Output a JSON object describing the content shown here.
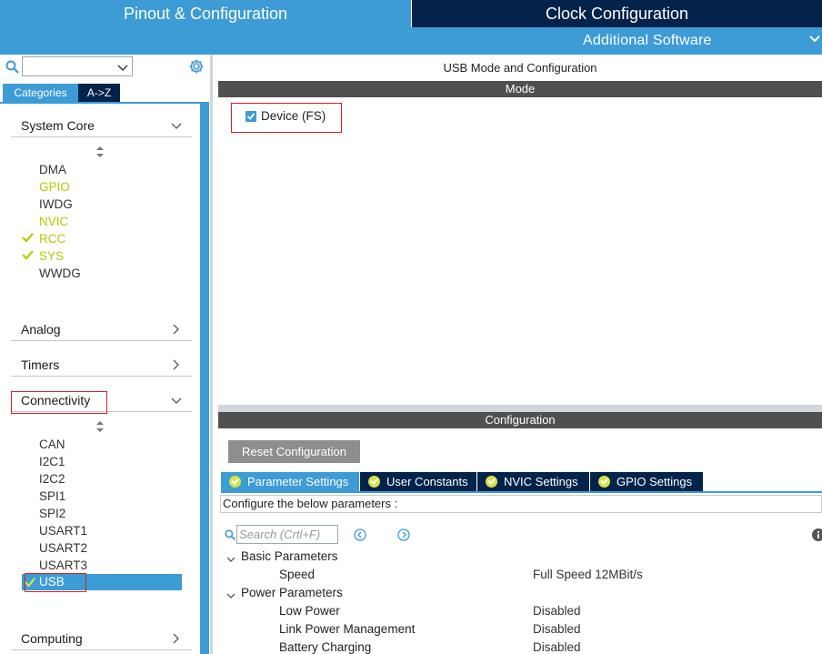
{
  "top_tabs": {
    "pinout": "Pinout & Configuration",
    "clock": "Clock Configuration"
  },
  "subbar": {
    "additional_software": "Additional Software"
  },
  "left": {
    "tabs": {
      "categories": "Categories",
      "az": "A->Z"
    },
    "categories": {
      "system_core": "System Core",
      "analog": "Analog",
      "timers": "Timers",
      "connectivity": "Connectivity",
      "computing": "Computing"
    },
    "system_core_items": [
      "DMA",
      "GPIO",
      "IWDG",
      "NVIC",
      "RCC",
      "SYS",
      "WWDG"
    ],
    "connectivity_items": [
      "CAN",
      "I2C1",
      "I2C2",
      "SPI1",
      "SPI2",
      "USART1",
      "USART2",
      "USART3",
      "USB"
    ]
  },
  "right": {
    "title": "USB Mode and Configuration",
    "mode_header": "Mode",
    "device_label": "Device (FS)",
    "config_header": "Configuration",
    "reset_button": "Reset Configuration",
    "config_tabs": [
      "Parameter Settings",
      "User Constants",
      "NVIC Settings",
      "GPIO Settings"
    ],
    "configure_text": "Configure the below parameters :",
    "search_placeholder": "Search (Crtl+F)",
    "groups": {
      "basic": "Basic Parameters",
      "power": "Power Parameters"
    },
    "params": [
      {
        "name": "Speed",
        "value": "Full Speed 12MBit/s"
      },
      {
        "name": "Low Power",
        "value": "Disabled"
      },
      {
        "name": "Link Power Management",
        "value": "Disabled"
      },
      {
        "name": "Battery Charging",
        "value": "Disabled"
      }
    ]
  },
  "colors": {
    "accent": "#3d9bd6",
    "dark_tab": "#03234b",
    "enabled_item": "#b8c800",
    "header_gray": "#505050",
    "highlight_box": "#d62020"
  }
}
